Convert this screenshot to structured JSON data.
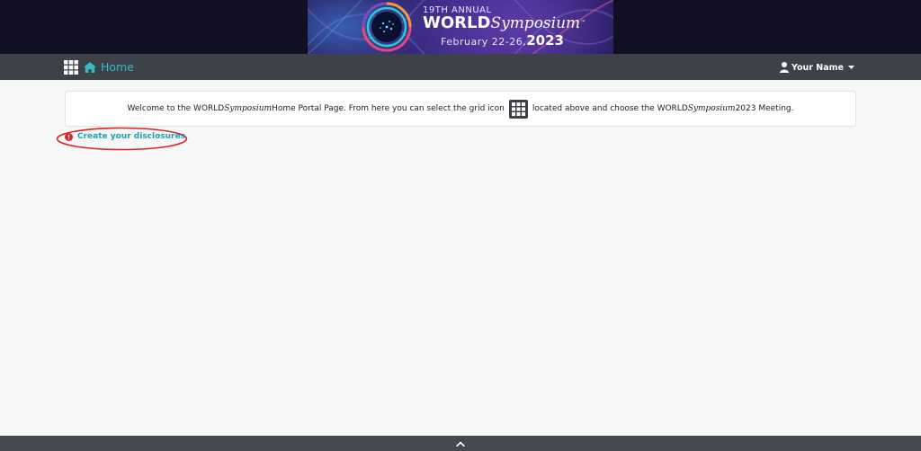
{
  "banner": {
    "annual": "19TH ANNUAL",
    "brand_main": "WORLD",
    "brand_italic": "Symposium",
    "trademark": "™",
    "dates": "February 22-26,",
    "year": "2023"
  },
  "navbar": {
    "grid_icon": "grid-icon",
    "home_icon": "home-icon",
    "home_label": "Home",
    "user_icon": "user-icon",
    "user_name": "Your Name",
    "caret_icon": "caret-down-icon"
  },
  "welcome": {
    "text_1": "Welcome to the WORLD",
    "text_2": "Symposium",
    "text_3": " Home Portal Page. From here you can select the grid icon",
    "text_4": "located above and choose the WORLD",
    "text_5": "Symposium",
    "text_6": " 2023 Meeting."
  },
  "disclosures": {
    "alert_icon": "exclamation-circle-icon",
    "label": "Create your disclosures",
    "highlight_color": "#d8232a"
  },
  "footer": {
    "scroll_icon": "chevron-up-icon"
  },
  "colors": {
    "navbar_bg": "#3c4247",
    "accent_teal": "#36b9c8",
    "page_bg": "#f6f7f7",
    "banner_bg": "#110f24"
  }
}
